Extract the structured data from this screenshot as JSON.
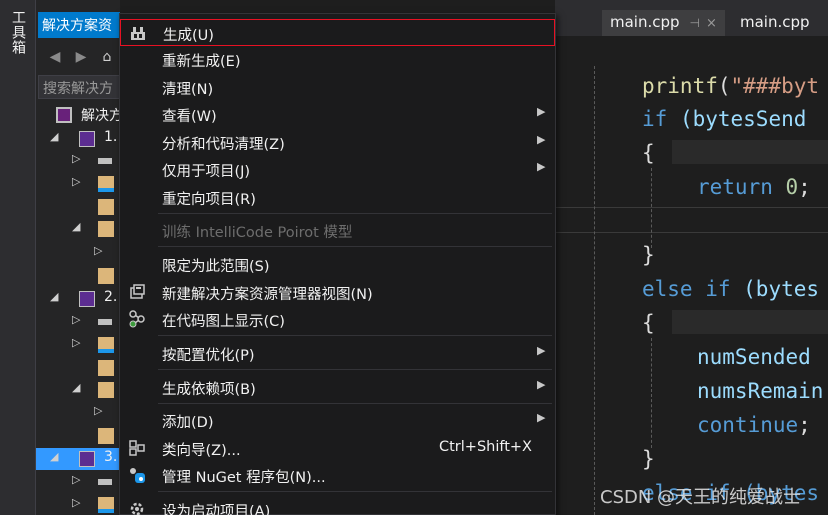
{
  "toolbox": {
    "label": "工具箱"
  },
  "solution_explorer": {
    "tab_title": "解决方案资",
    "search_placeholder": "搜索解决方",
    "solution_label": "解决方",
    "project_labels": [
      "1.",
      "2.",
      "3."
    ]
  },
  "editor": {
    "tabs": [
      {
        "label": "main.cpp",
        "pin": "⊣",
        "close": "×"
      },
      {
        "label": "main.cpp"
      }
    ],
    "code": {
      "l1_fn": "printf",
      "l1_paren": "(",
      "l1_str": "\"###byt",
      "l2_kw": "if",
      "l2_rest": " (bytesSend",
      "l3": "{",
      "l4_kw": "return",
      "l4_num": " 0",
      "l4_semi": ";",
      "l5": "}",
      "l6_kw": "else if",
      "l6_rest": " (bytes",
      "l7": "{",
      "l8": "numSended",
      "l9": "numsRemain",
      "l10_kw": "continue",
      "l10_semi": ";",
      "l11": "}",
      "l12": "else if (bytes"
    },
    "watermark": "CSDN @天王的纯爱战士"
  },
  "context_menu": {
    "items": [
      {
        "label": "生成(U)",
        "icon": "build-icon",
        "highlighted": true
      },
      {
        "label": "重新生成(E)"
      },
      {
        "label": "清理(N)"
      },
      {
        "label": "查看(W)",
        "submenu": true
      },
      {
        "label": "分析和代码清理(Z)",
        "submenu": true
      },
      {
        "label": "仅用于项目(J)",
        "submenu": true
      },
      {
        "label": "重定向项目(R)"
      },
      {
        "label": "训练 IntelliCode Poirot 模型",
        "disabled": true
      },
      {
        "label": "限定为此范围(S)"
      },
      {
        "label": "新建解决方案资源管理器视图(N)",
        "icon": "new-view-icon"
      },
      {
        "label": "在代码图上显示(C)",
        "icon": "code-map-icon"
      },
      {
        "label": "按配置优化(P)",
        "submenu": true
      },
      {
        "label": "生成依赖项(B)",
        "submenu": true
      },
      {
        "label": "添加(D)",
        "submenu": true
      },
      {
        "label": "类向导(Z)...",
        "shortcut": "Ctrl+Shift+X",
        "icon": "class-wizard-icon"
      },
      {
        "label": "管理 NuGet 程序包(N)...",
        "icon": "nuget-icon"
      },
      {
        "label": "设为启动项目(A)",
        "icon": "gear-icon"
      }
    ],
    "submenu_arrow": "▶"
  },
  "colors": {
    "accent": "#007acc",
    "highlight_border": "#e81123",
    "selection": "#3399ff"
  }
}
